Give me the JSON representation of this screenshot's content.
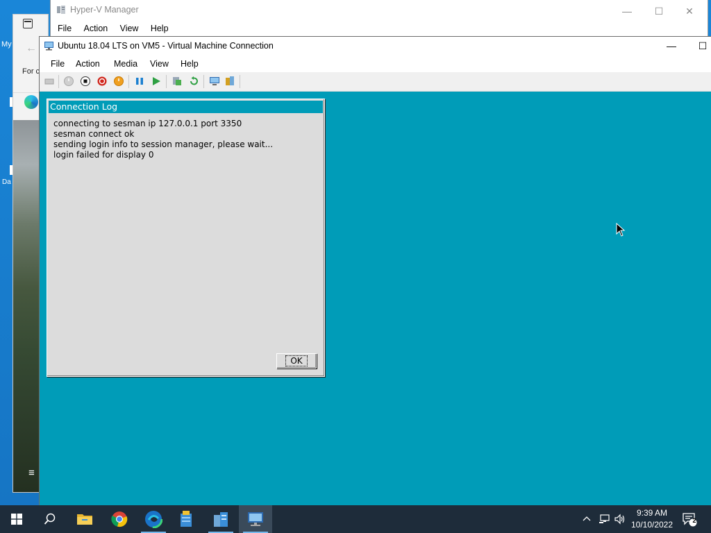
{
  "desktop": {
    "labels": [
      "My",
      "Da"
    ],
    "edge_partial": {
      "back_glyph": "←",
      "text": "For c",
      "menu_glyph": "≡"
    }
  },
  "hyperv_manager": {
    "title": "Hyper-V Manager",
    "menu": [
      "File",
      "Action",
      "View",
      "Help"
    ],
    "window_buttons": {
      "minimize": "—",
      "maximize": "☐",
      "close": "✕"
    }
  },
  "vm_connection": {
    "title": "Ubuntu 18.04 LTS on VM5 - Virtual Machine Connection",
    "menu": [
      "File",
      "Action",
      "Media",
      "View",
      "Help"
    ],
    "window_buttons": {
      "minimize": "—",
      "maximize": "☐"
    },
    "toolbar_icons": [
      "ctrl-alt-del-icon",
      "start-icon",
      "turn-off-icon",
      "shutdown-icon",
      "save-state-icon",
      "pause-icon",
      "resume-icon",
      "checkpoint-icon",
      "revert-icon",
      "enhanced-session-icon",
      "share-icon"
    ]
  },
  "dialog": {
    "title": "Connection Log",
    "lines": [
      "connecting to sesman ip 127.0.0.1 port 3350",
      "sesman connect ok",
      "sending login info to session manager, please wait...",
      "login failed for display 0"
    ],
    "ok_label": "OK"
  },
  "taskbar": {
    "apps": [
      "start-icon",
      "search-icon",
      "file-explorer-icon",
      "chrome-icon",
      "edge-icon",
      "server-manager-icon",
      "hyperv-manager-icon",
      "vm-connection-icon"
    ],
    "active_app": "vm-connection-icon",
    "clock_time": "9:39 AM",
    "clock_date": "10/10/2022",
    "notification_count": "2"
  },
  "colors": {
    "vm_screen": "#009cb8",
    "taskbar": "#1e2c3a",
    "desktop": "#1a86d8"
  }
}
